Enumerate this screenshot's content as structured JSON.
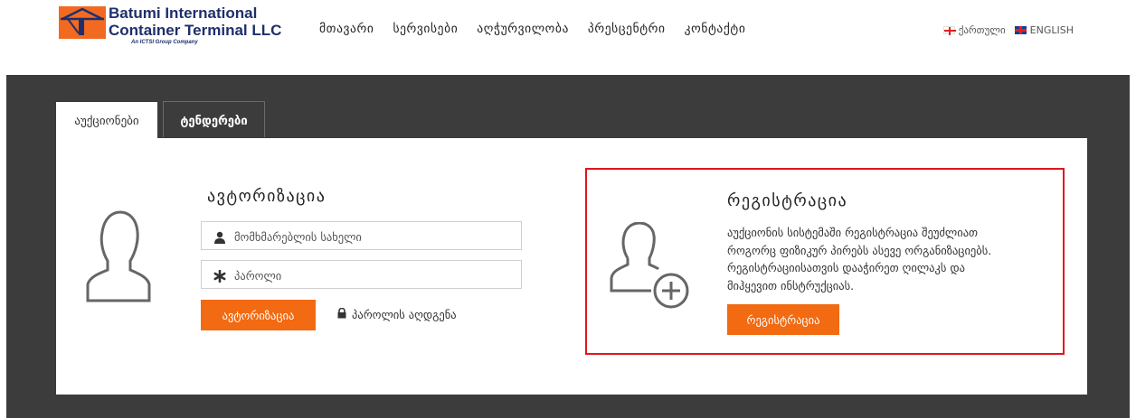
{
  "header": {
    "logo": {
      "line1": "Batumi International",
      "line2": "Container Terminal LLC",
      "sub": "An ICTSI Group Company"
    },
    "nav": [
      "მთავარი",
      "სერვისები",
      "აღჭურვილობა",
      "პრესცენტრი",
      "კონტაქტი"
    ],
    "languages": [
      "ქართული",
      "ENGLISH"
    ]
  },
  "tabs": [
    {
      "label": "აუქციონები",
      "active": true
    },
    {
      "label": "ტენდერები",
      "active": false
    }
  ],
  "login": {
    "title": "ავტორიზაცია",
    "username_placeholder": "მომხმარებლის სახელი",
    "password_placeholder": "პაროლი",
    "button": "ავტორიზაცია",
    "forgot": "პაროლის აღდგენა"
  },
  "registration": {
    "title": "რეგისტრაცია",
    "text_lines": [
      "აუქციონის სისტემაში რეგისტრაცია შეუძლიათ",
      "როგორც ფიზიკურ პირებს ასევე ორგანიზაციებს.",
      "რეგისტრაციისათვის დააჭირეთ ღილაკს და",
      "მიჰყევით ინსტრუქციას."
    ],
    "button": "რეგისტრაცია"
  },
  "colors": {
    "accent": "#f26a11",
    "panel": "#3c3c3c",
    "highlight": "#e0141e",
    "brand_navy": "#1f2f6b"
  }
}
